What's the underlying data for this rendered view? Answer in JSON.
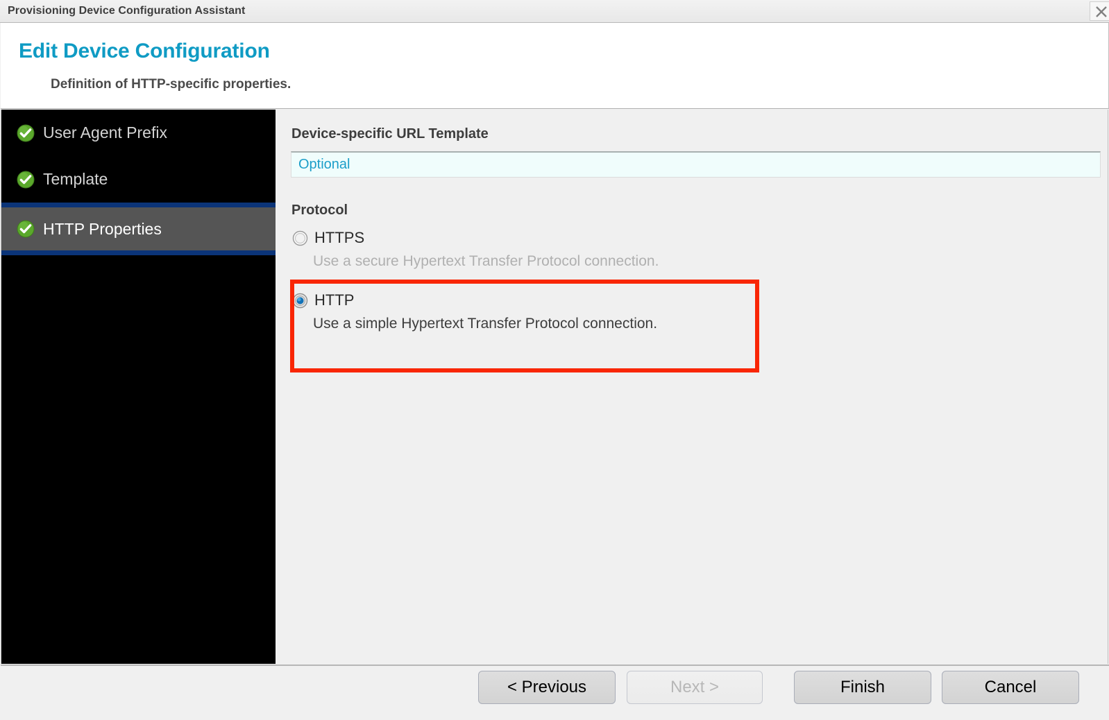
{
  "titlebar": {
    "title": "Provisioning Device Configuration Assistant",
    "close_icon": "close-icon"
  },
  "header": {
    "title": "Edit Device Configuration",
    "subtitle": "Definition of HTTP-specific properties.",
    "accent_color": "#0f9bc4"
  },
  "sidebar": {
    "background_color": "#000000",
    "selected_background_color": "#555555",
    "selected_rule_color": "#0b3478",
    "items": [
      {
        "label": "User Agent Prefix",
        "icon": "green-check-icon",
        "completed": true,
        "selected": false
      },
      {
        "label": "Template",
        "icon": "green-check-icon",
        "completed": true,
        "selected": false
      },
      {
        "label": "HTTP Properties",
        "icon": "green-check-icon",
        "completed": true,
        "selected": true
      }
    ]
  },
  "main": {
    "url_template": {
      "label": "Device-specific URL Template",
      "value": "",
      "placeholder": "Optional",
      "placeholder_color": "#1c9ec9",
      "background_color": "#f0fdfc"
    },
    "protocol": {
      "label": "Protocol",
      "selected": "HTTP",
      "options": [
        {
          "label": "HTTPS",
          "description": "Use a secure Hypertext Transfer Protocol connection.",
          "selected": false,
          "enabled": false
        },
        {
          "label": "HTTP",
          "description": "Use a simple Hypertext Transfer Protocol connection.",
          "selected": true,
          "enabled": true
        }
      ]
    },
    "highlight": {
      "target": "HTTP",
      "color": "#f92605",
      "stroke_width": 6
    }
  },
  "footer": {
    "buttons": [
      {
        "label": "< Previous",
        "enabled": true
      },
      {
        "label": "Next >",
        "enabled": false
      },
      {
        "label": "Finish",
        "enabled": true
      },
      {
        "label": "Cancel",
        "enabled": true
      }
    ]
  }
}
